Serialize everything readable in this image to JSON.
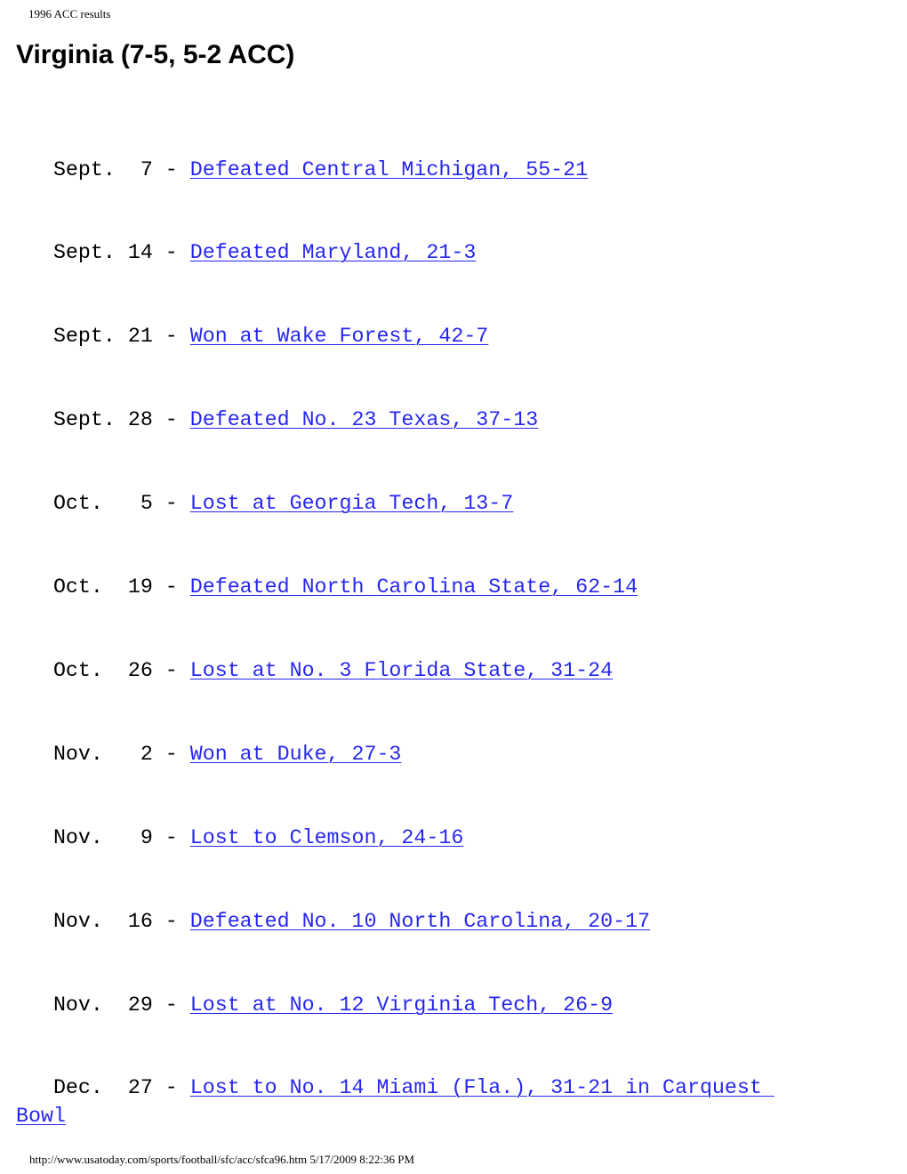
{
  "header": {
    "document_title": "1996 ACC results"
  },
  "page_title": "Virginia (7-5, 5-2 ACC)",
  "results": [
    {
      "date_prefix": "   Sept.  7 - ",
      "result": "Defeated Central Michigan, 55-21"
    },
    {
      "date_prefix": "   Sept. 14 - ",
      "result": "Defeated Maryland, 21-3"
    },
    {
      "date_prefix": "   Sept. 21 - ",
      "result": "Won at Wake Forest, 42-7"
    },
    {
      "date_prefix": "   Sept. 28 - ",
      "result": "Defeated No. 23 Texas, 37-13"
    },
    {
      "date_prefix": "   Oct.   5 - ",
      "result": "Lost at Georgia Tech, 13-7"
    },
    {
      "date_prefix": "   Oct.  19 - ",
      "result": "Defeated North Carolina State, 62-14"
    },
    {
      "date_prefix": "   Oct.  26 - ",
      "result": "Lost at No. 3 Florida State, 31-24"
    },
    {
      "date_prefix": "   Nov.   2 - ",
      "result": "Won at Duke, 27-3"
    },
    {
      "date_prefix": "   Nov.   9 - ",
      "result": "Lost to Clemson, 24-16"
    },
    {
      "date_prefix": "   Nov.  16 - ",
      "result": "Defeated No. 10 North Carolina, 20-17"
    },
    {
      "date_prefix": "   Nov.  29 - ",
      "result": "Lost at No. 12 Virginia Tech, 26-9"
    },
    {
      "date_prefix": "   Dec.  27 - ",
      "result": "Lost to No. 14 Miami (Fla.), 31-21 in Carquest Bowl"
    }
  ],
  "footer": {
    "url": "http://www.usatoday.com/sports/football/sfc/acc/sfca96.htm",
    "timestamp": "5/17/2009 8:22:36 PM"
  },
  "colors": {
    "link": "#0000ee",
    "text": "#000000",
    "background": "#ffffff"
  }
}
